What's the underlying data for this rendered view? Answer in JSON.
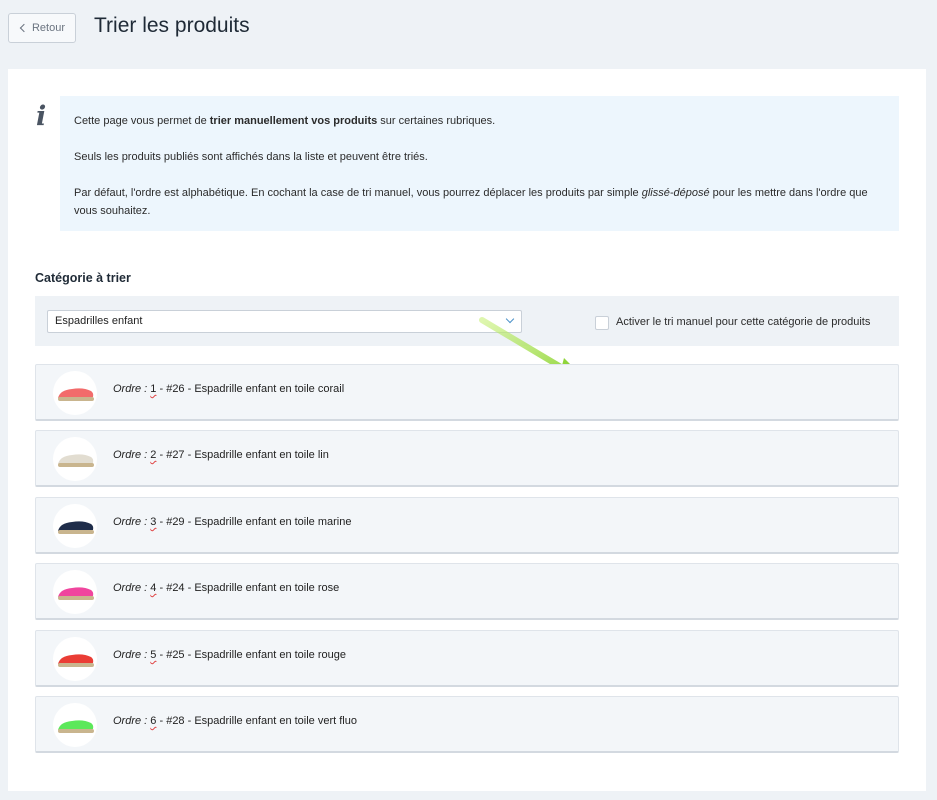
{
  "header": {
    "back_label": "Retour",
    "title": "Trier les produits"
  },
  "info": {
    "icon": "info-icon",
    "p1_before": "Cette page vous permet de ",
    "p1_bold": "trier manuellement vos produits",
    "p1_after": " sur certaines rubriques.",
    "p2": "Seuls les produits publiés sont affichés dans la liste et peuvent être triés.",
    "p3_before": "Par défaut, l'ordre est alphabétique. En cochant la case de tri manuel, vous pourrez déplacer les produits par simple ",
    "p3_italic": "glissé-déposé",
    "p3_after": " pour les mettre dans l'ordre que vous souhaitez."
  },
  "filter": {
    "section_title": "Catégorie à trier",
    "selected_category": "Espadrilles enfant",
    "manual_sort_label": "Activer le tri manuel pour cette catégorie de produits",
    "manual_sort_checked": false
  },
  "products": [
    {
      "order_label": "Ordre :",
      "order": "1",
      "rest": " - #26 - Espadrille enfant en toile corail",
      "color": "#f26b6b"
    },
    {
      "order_label": "Ordre :",
      "order": "2",
      "rest": " - #27 - Espadrille enfant en toile lin",
      "color": "#e2ddd1"
    },
    {
      "order_label": "Ordre :",
      "order": "3",
      "rest": " - #29 - Espadrille enfant en toile marine",
      "color": "#1f2d4a"
    },
    {
      "order_label": "Ordre :",
      "order": "4",
      "rest": " - #24 - Espadrille enfant en toile rose",
      "color": "#f0459e"
    },
    {
      "order_label": "Ordre :",
      "order": "5",
      "rest": " - #25 - Espadrille enfant en toile rouge",
      "color": "#ea3d35"
    },
    {
      "order_label": "Ordre :",
      "order": "6",
      "rest": " - #28 - Espadrille enfant en toile vert fluo",
      "color": "#5ce85a"
    }
  ],
  "colors": {
    "arrow": "#8fd43a",
    "sole": "#c9b58e"
  }
}
